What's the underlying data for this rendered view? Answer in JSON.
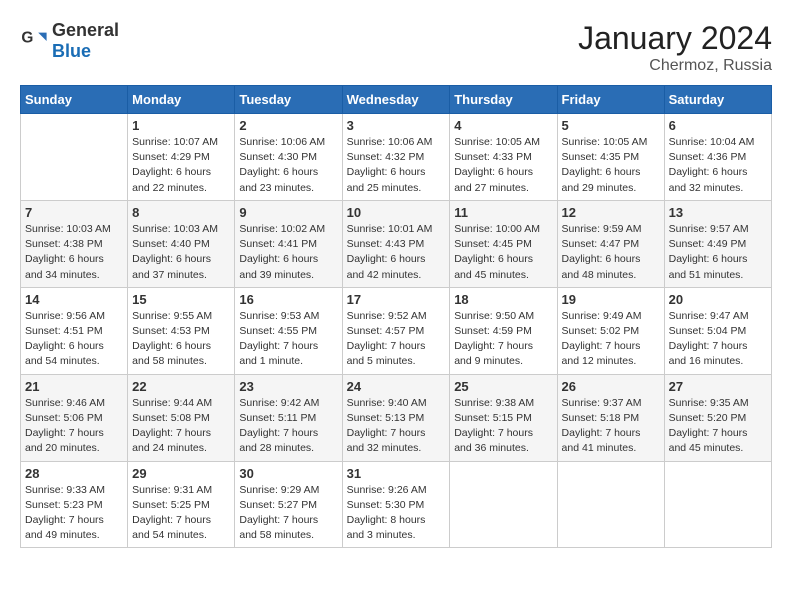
{
  "header": {
    "logo_general": "General",
    "logo_blue": "Blue",
    "month_year": "January 2024",
    "location": "Chermoz, Russia"
  },
  "weekdays": [
    "Sunday",
    "Monday",
    "Tuesday",
    "Wednesday",
    "Thursday",
    "Friday",
    "Saturday"
  ],
  "weeks": [
    [
      {
        "day": "",
        "info": ""
      },
      {
        "day": "1",
        "info": "Sunrise: 10:07 AM\nSunset: 4:29 PM\nDaylight: 6 hours\nand 22 minutes."
      },
      {
        "day": "2",
        "info": "Sunrise: 10:06 AM\nSunset: 4:30 PM\nDaylight: 6 hours\nand 23 minutes."
      },
      {
        "day": "3",
        "info": "Sunrise: 10:06 AM\nSunset: 4:32 PM\nDaylight: 6 hours\nand 25 minutes."
      },
      {
        "day": "4",
        "info": "Sunrise: 10:05 AM\nSunset: 4:33 PM\nDaylight: 6 hours\nand 27 minutes."
      },
      {
        "day": "5",
        "info": "Sunrise: 10:05 AM\nSunset: 4:35 PM\nDaylight: 6 hours\nand 29 minutes."
      },
      {
        "day": "6",
        "info": "Sunrise: 10:04 AM\nSunset: 4:36 PM\nDaylight: 6 hours\nand 32 minutes."
      }
    ],
    [
      {
        "day": "7",
        "info": "Sunrise: 10:03 AM\nSunset: 4:38 PM\nDaylight: 6 hours\nand 34 minutes."
      },
      {
        "day": "8",
        "info": "Sunrise: 10:03 AM\nSunset: 4:40 PM\nDaylight: 6 hours\nand 37 minutes."
      },
      {
        "day": "9",
        "info": "Sunrise: 10:02 AM\nSunset: 4:41 PM\nDaylight: 6 hours\nand 39 minutes."
      },
      {
        "day": "10",
        "info": "Sunrise: 10:01 AM\nSunset: 4:43 PM\nDaylight: 6 hours\nand 42 minutes."
      },
      {
        "day": "11",
        "info": "Sunrise: 10:00 AM\nSunset: 4:45 PM\nDaylight: 6 hours\nand 45 minutes."
      },
      {
        "day": "12",
        "info": "Sunrise: 9:59 AM\nSunset: 4:47 PM\nDaylight: 6 hours\nand 48 minutes."
      },
      {
        "day": "13",
        "info": "Sunrise: 9:57 AM\nSunset: 4:49 PM\nDaylight: 6 hours\nand 51 minutes."
      }
    ],
    [
      {
        "day": "14",
        "info": "Sunrise: 9:56 AM\nSunset: 4:51 PM\nDaylight: 6 hours\nand 54 minutes."
      },
      {
        "day": "15",
        "info": "Sunrise: 9:55 AM\nSunset: 4:53 PM\nDaylight: 6 hours\nand 58 minutes."
      },
      {
        "day": "16",
        "info": "Sunrise: 9:53 AM\nSunset: 4:55 PM\nDaylight: 7 hours\nand 1 minute."
      },
      {
        "day": "17",
        "info": "Sunrise: 9:52 AM\nSunset: 4:57 PM\nDaylight: 7 hours\nand 5 minutes."
      },
      {
        "day": "18",
        "info": "Sunrise: 9:50 AM\nSunset: 4:59 PM\nDaylight: 7 hours\nand 9 minutes."
      },
      {
        "day": "19",
        "info": "Sunrise: 9:49 AM\nSunset: 5:02 PM\nDaylight: 7 hours\nand 12 minutes."
      },
      {
        "day": "20",
        "info": "Sunrise: 9:47 AM\nSunset: 5:04 PM\nDaylight: 7 hours\nand 16 minutes."
      }
    ],
    [
      {
        "day": "21",
        "info": "Sunrise: 9:46 AM\nSunset: 5:06 PM\nDaylight: 7 hours\nand 20 minutes."
      },
      {
        "day": "22",
        "info": "Sunrise: 9:44 AM\nSunset: 5:08 PM\nDaylight: 7 hours\nand 24 minutes."
      },
      {
        "day": "23",
        "info": "Sunrise: 9:42 AM\nSunset: 5:11 PM\nDaylight: 7 hours\nand 28 minutes."
      },
      {
        "day": "24",
        "info": "Sunrise: 9:40 AM\nSunset: 5:13 PM\nDaylight: 7 hours\nand 32 minutes."
      },
      {
        "day": "25",
        "info": "Sunrise: 9:38 AM\nSunset: 5:15 PM\nDaylight: 7 hours\nand 36 minutes."
      },
      {
        "day": "26",
        "info": "Sunrise: 9:37 AM\nSunset: 5:18 PM\nDaylight: 7 hours\nand 41 minutes."
      },
      {
        "day": "27",
        "info": "Sunrise: 9:35 AM\nSunset: 5:20 PM\nDaylight: 7 hours\nand 45 minutes."
      }
    ],
    [
      {
        "day": "28",
        "info": "Sunrise: 9:33 AM\nSunset: 5:23 PM\nDaylight: 7 hours\nand 49 minutes."
      },
      {
        "day": "29",
        "info": "Sunrise: 9:31 AM\nSunset: 5:25 PM\nDaylight: 7 hours\nand 54 minutes."
      },
      {
        "day": "30",
        "info": "Sunrise: 9:29 AM\nSunset: 5:27 PM\nDaylight: 7 hours\nand 58 minutes."
      },
      {
        "day": "31",
        "info": "Sunrise: 9:26 AM\nSunset: 5:30 PM\nDaylight: 8 hours\nand 3 minutes."
      },
      {
        "day": "",
        "info": ""
      },
      {
        "day": "",
        "info": ""
      },
      {
        "day": "",
        "info": ""
      }
    ]
  ]
}
